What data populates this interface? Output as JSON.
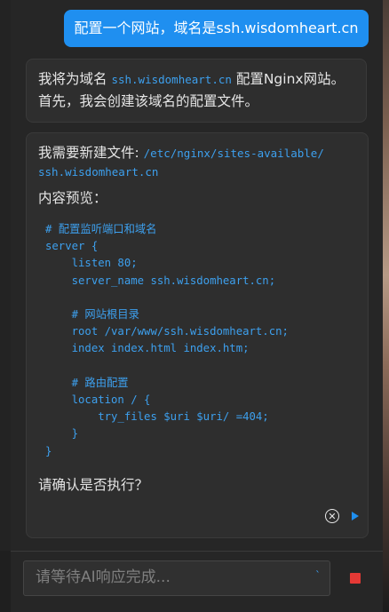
{
  "chat": {
    "user_message": "配置一个网站，域名是ssh.wisdomheart.cn",
    "ai_intro": {
      "prefix": "我将为域名 ",
      "domain": "ssh.wisdomheart.cn",
      "suffix": " 配置Nginx网站。",
      "line2": "首先，我会创建该域名的配置文件。"
    },
    "ai_file": {
      "prefix": "我需要新建文件: ",
      "path_part1": "/etc/nginx/sites-available/",
      "path_part2": "ssh.wisdomheart.cn",
      "preview_label": "内容预览：",
      "code": "# 配置监听端口和域名\nserver {\n    listen 80;\n    server_name ssh.wisdomheart.cn;\n\n    # 网站根目录\n    root /var/www/ssh.wisdomheart.cn;\n    index index.html index.htm;\n\n    # 路由配置\n    location / {\n        try_files $uri $uri/ =404;\n    }\n}",
      "confirm": "请确认是否执行？"
    }
  },
  "actions": {
    "cancel_icon": "circle-x-icon",
    "cancel_glyph": "✕",
    "run_icon": "play-icon"
  },
  "input": {
    "placeholder": "请等待AI响应完成...",
    "value": "",
    "mark": "`"
  },
  "stop": {
    "icon": "stop-icon"
  },
  "colors": {
    "accent": "#1f8ff0",
    "stop": "#e53935",
    "code": "#3da0ee"
  }
}
